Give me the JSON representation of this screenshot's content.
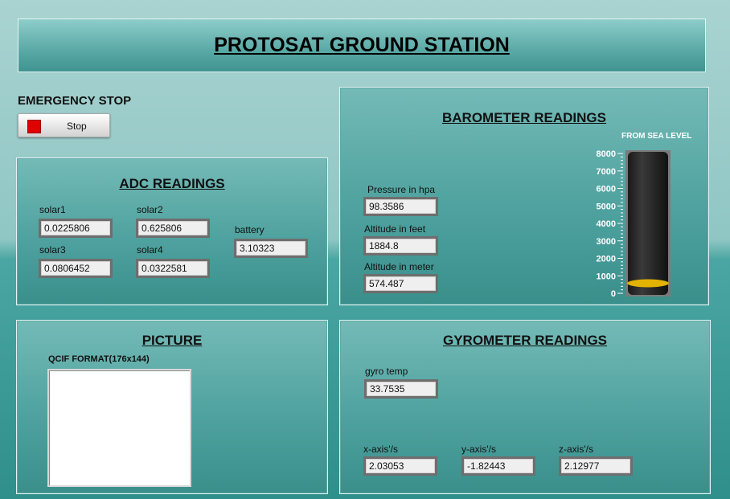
{
  "app_title": "PROTOSAT GROUND STATION",
  "emergency": {
    "label": "EMERGENCY STOP",
    "button_label": "Stop",
    "led_color": "#e00000"
  },
  "adc": {
    "title": "ADC READINGS",
    "solar1": {
      "label": "solar1",
      "value": "0.0225806"
    },
    "solar2": {
      "label": "solar2",
      "value": "0.625806"
    },
    "solar3": {
      "label": "solar3",
      "value": "0.0806452"
    },
    "solar4": {
      "label": "solar4",
      "value": "0.0322581"
    },
    "battery": {
      "label": "battery",
      "value": "3.10323"
    }
  },
  "barometer": {
    "title": "BAROMETER READINGS",
    "pressure": {
      "label": "Pressure in hpa",
      "value": "98.3586"
    },
    "alt_feet": {
      "label": "Altitude in feet",
      "value": "1884.8"
    },
    "alt_meter": {
      "label": "Altitude in meter",
      "value": "574.487"
    },
    "tank": {
      "label": "FROM SEA LEVEL",
      "ticks": [
        "8000",
        "7000",
        "6000",
        "5000",
        "4000",
        "3000",
        "2000",
        "1000",
        "0"
      ],
      "max": 8000,
      "level": 574.487,
      "fill_color": "#e2b300"
    }
  },
  "picture": {
    "title": "PICTURE",
    "format_label": "QCIF FORMAT(176x144)"
  },
  "gyro": {
    "title": "GYROMETER READINGS",
    "temp": {
      "label": "gyro temp",
      "value": "33.7535"
    },
    "x": {
      "label": "x-axis'/s",
      "value": "2.03053"
    },
    "y": {
      "label": "y-axis'/s",
      "value": "-1.82443"
    },
    "z": {
      "label": "z-axis'/s",
      "value": "2.12977"
    }
  }
}
